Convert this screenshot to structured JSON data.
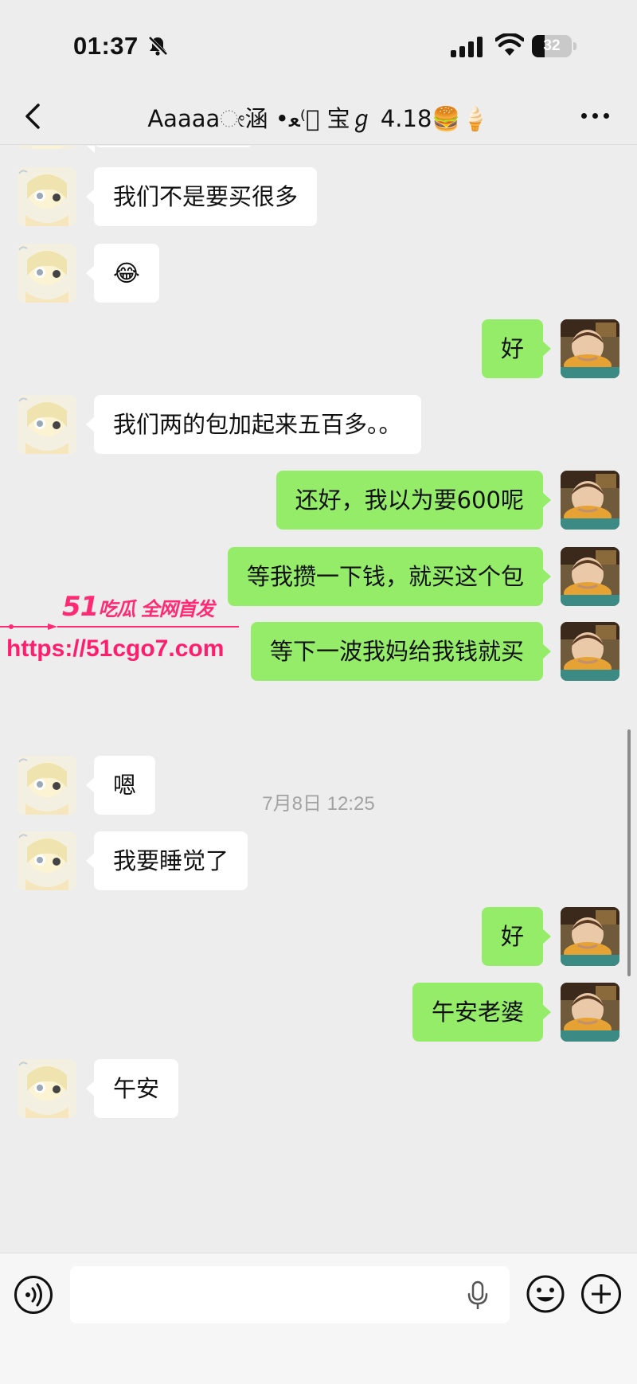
{
  "status_bar": {
    "time": "01:37",
    "battery": "32",
    "battery_level": 0.32,
    "icons": [
      "bell-slash-icon",
      "cellular-signal-icon",
      "wifi-icon",
      "battery-icon"
    ]
  },
  "header": {
    "title": "Aaaaaೕ涵 •ﻌ⁽ ⃕宝ℊ 4.18🍔🍦",
    "icons": [
      "chevron-left-icon",
      "more-icon"
    ]
  },
  "messages": [
    {
      "side": "left",
      "type": "text",
      "text": "我们不是要买很多"
    },
    {
      "side": "left",
      "type": "emoji",
      "text": "😂"
    },
    {
      "side": "right",
      "type": "text",
      "text": "好"
    },
    {
      "side": "left",
      "type": "text",
      "text": "我们两的包加起来五百多。。"
    },
    {
      "side": "right",
      "type": "text",
      "text": "还好，我以为要600呢"
    },
    {
      "side": "right",
      "type": "text",
      "text": "等我攒一下钱，就买这个包"
    },
    {
      "side": "right",
      "type": "text",
      "text": "等下一波我妈给我钱就买"
    },
    {
      "side": "left",
      "type": "text",
      "text": "嗯"
    },
    {
      "side": "left",
      "type": "text",
      "text": "我要睡觉了"
    },
    {
      "side": "right",
      "type": "text",
      "text": "好"
    },
    {
      "side": "right",
      "type": "text",
      "text": "午安老婆"
    },
    {
      "side": "left",
      "type": "text",
      "text": "午安"
    }
  ],
  "timestamp": "7月8日 12:25",
  "watermark": {
    "title_number": "51",
    "title_text": "吃瓜 全网首发",
    "url": "https://51cgo7.com"
  },
  "input_bar": {
    "placeholder": "",
    "icons": [
      "voice-icon",
      "microphone-icon",
      "emoji-icon",
      "add-icon"
    ]
  },
  "colors": {
    "background": "#ededed",
    "sent_bubble": "#95ec69",
    "received_bubble": "#ffffff",
    "watermark": "#ff2a73"
  }
}
